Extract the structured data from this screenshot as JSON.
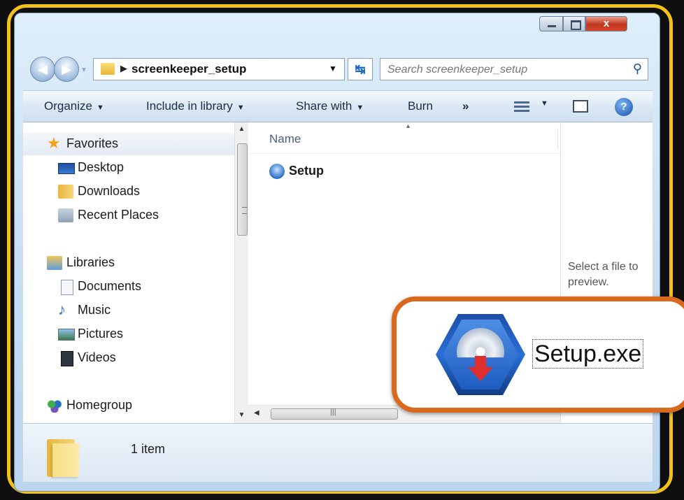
{
  "window": {
    "close_glyph": "x",
    "accent": "#f2c219",
    "callout_accent": "#d96a1d"
  },
  "address_bar": {
    "path": "screenkeeper_setup"
  },
  "search": {
    "placeholder": "Search screenkeeper_setup"
  },
  "toolbar": {
    "organize": "Organize",
    "include": "Include in library",
    "share": "Share with",
    "burn": "Burn",
    "more": "»"
  },
  "nav_pane": {
    "favorites": "Favorites",
    "desktop": "Desktop",
    "downloads": "Downloads",
    "recent": "Recent Places",
    "libraries": "Libraries",
    "documents": "Documents",
    "music": "Music",
    "pictures": "Pictures",
    "videos": "Videos",
    "homegroup": "Homegroup"
  },
  "file_list": {
    "col_name": "Name",
    "files": [
      {
        "name": "Setup",
        "icon": "setup-icon"
      }
    ]
  },
  "preview": {
    "message": "Select a file to preview."
  },
  "status": {
    "count": "1 item"
  },
  "callout": {
    "filename": "Setup.exe",
    "icon": "installer-icon"
  }
}
